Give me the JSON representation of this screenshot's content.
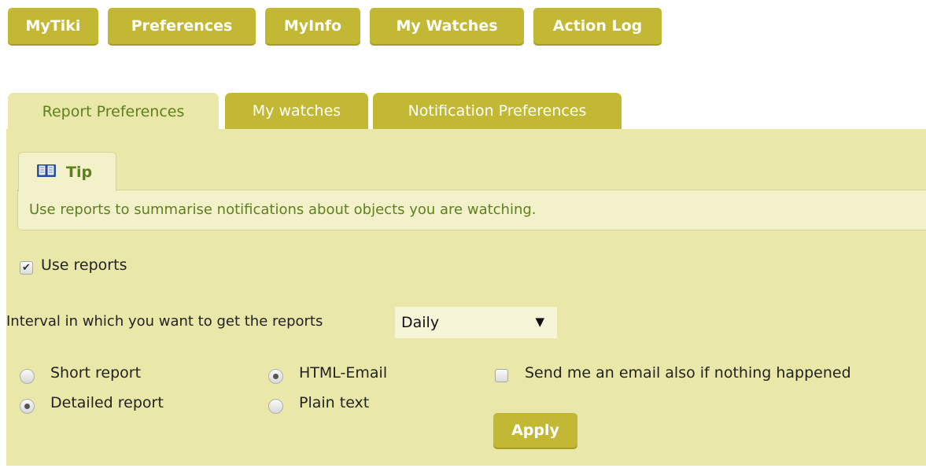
{
  "topnav": {
    "items": [
      {
        "label": "MyTiki"
      },
      {
        "label": "Preferences"
      },
      {
        "label": "MyInfo"
      },
      {
        "label": "My Watches"
      },
      {
        "label": "Action Log"
      }
    ]
  },
  "tabs": [
    {
      "label": "Report Preferences",
      "active": true
    },
    {
      "label": "My watches",
      "active": false
    },
    {
      "label": "Notification Preferences",
      "active": false
    }
  ],
  "tip": {
    "icon": "book-icon",
    "title": "Tip",
    "text": "Use reports to summarise notifications about objects you are watching."
  },
  "form": {
    "use_reports": {
      "label": "Use reports",
      "checked": true
    },
    "interval": {
      "label": "Interval in which you want to get the reports",
      "selected": "Daily"
    },
    "report_type": {
      "options": [
        {
          "label": "Short report",
          "selected": false
        },
        {
          "label": "Detailed report",
          "selected": true
        }
      ]
    },
    "format": {
      "options": [
        {
          "label": "HTML-Email",
          "selected": true
        },
        {
          "label": "Plain text",
          "selected": false
        }
      ]
    },
    "always_email": {
      "label": "Send me an email also if nothing happened",
      "checked": false
    },
    "apply_label": "Apply"
  },
  "colors": {
    "accent": "#c2b834",
    "panel": "#eae8a8",
    "tip_bg": "#f2f1c9",
    "tip_text": "#5f7f1e"
  }
}
